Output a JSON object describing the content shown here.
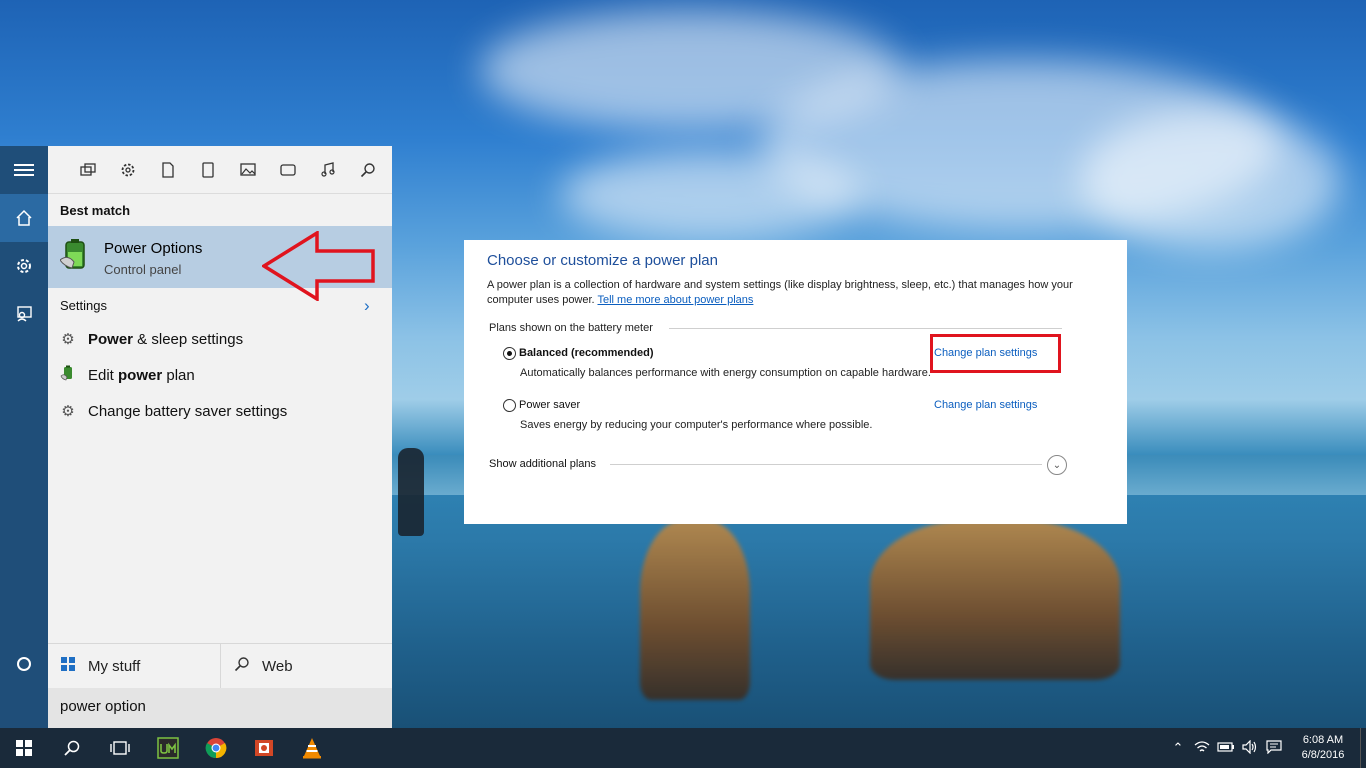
{
  "desktop": {
    "wallpaper": "beach-sky-reflection"
  },
  "left_rail": {
    "items": [
      {
        "icon": "hamburger-icon"
      },
      {
        "icon": "home-icon"
      },
      {
        "icon": "gear-icon"
      },
      {
        "icon": "feedback-icon"
      },
      {
        "icon": "cortana-circle-icon"
      }
    ]
  },
  "search_panel": {
    "filters": [
      "apps-icon",
      "settings-icon",
      "document-icon",
      "tablet-icon",
      "photos-icon",
      "video-icon",
      "music-icon",
      "search-icon"
    ],
    "best_match_heading": "Best match",
    "best_match": {
      "title": "Power Options",
      "subtitle": "Control panel"
    },
    "settings_heading": "Settings",
    "settings_results": [
      {
        "bold": "Power",
        "rest": " & sleep settings",
        "icon": "gear-icon"
      },
      {
        "pre": "Edit ",
        "bold": "power",
        "rest": " plan",
        "icon": "battery-icon"
      },
      {
        "pre": "Change battery saver settings",
        "icon": "gear-icon"
      }
    ],
    "scope_mystuff": "My stuff",
    "scope_web": "Web",
    "query": "power option"
  },
  "power_window": {
    "title": "Choose or customize a power plan",
    "description": "A power plan is a collection of hardware and system settings (like display brightness, sleep, etc.) that manages how your computer uses power.",
    "learn_more": "Tell me more about power plans",
    "plans_heading": "Plans shown on the battery meter",
    "plans": [
      {
        "name": "Balanced (recommended)",
        "description": "Automatically balances performance with energy consumption on capable hardware.",
        "link": "Change plan settings",
        "selected": true
      },
      {
        "name": "Power saver",
        "description": "Saves energy by reducing your computer's performance where possible.",
        "link": "Change plan settings",
        "selected": false
      }
    ],
    "additional": "Show additional plans"
  },
  "taskbar": {
    "buttons": [
      "windows-start-icon",
      "search-icon",
      "task-view-icon",
      "um-app-icon",
      "chrome-icon",
      "powerpoint-icon",
      "vlc-icon"
    ],
    "tray": [
      "chevron-up-icon",
      "wifi-icon",
      "battery-icon",
      "volume-icon",
      "action-center-icon"
    ],
    "time": "6:08 AM",
    "date": "6/8/2016"
  },
  "colors": {
    "accent": "#1f4e79",
    "link": "#0b5ebf",
    "annotation_red": "#e0141e",
    "selection": "#b7cde2"
  }
}
